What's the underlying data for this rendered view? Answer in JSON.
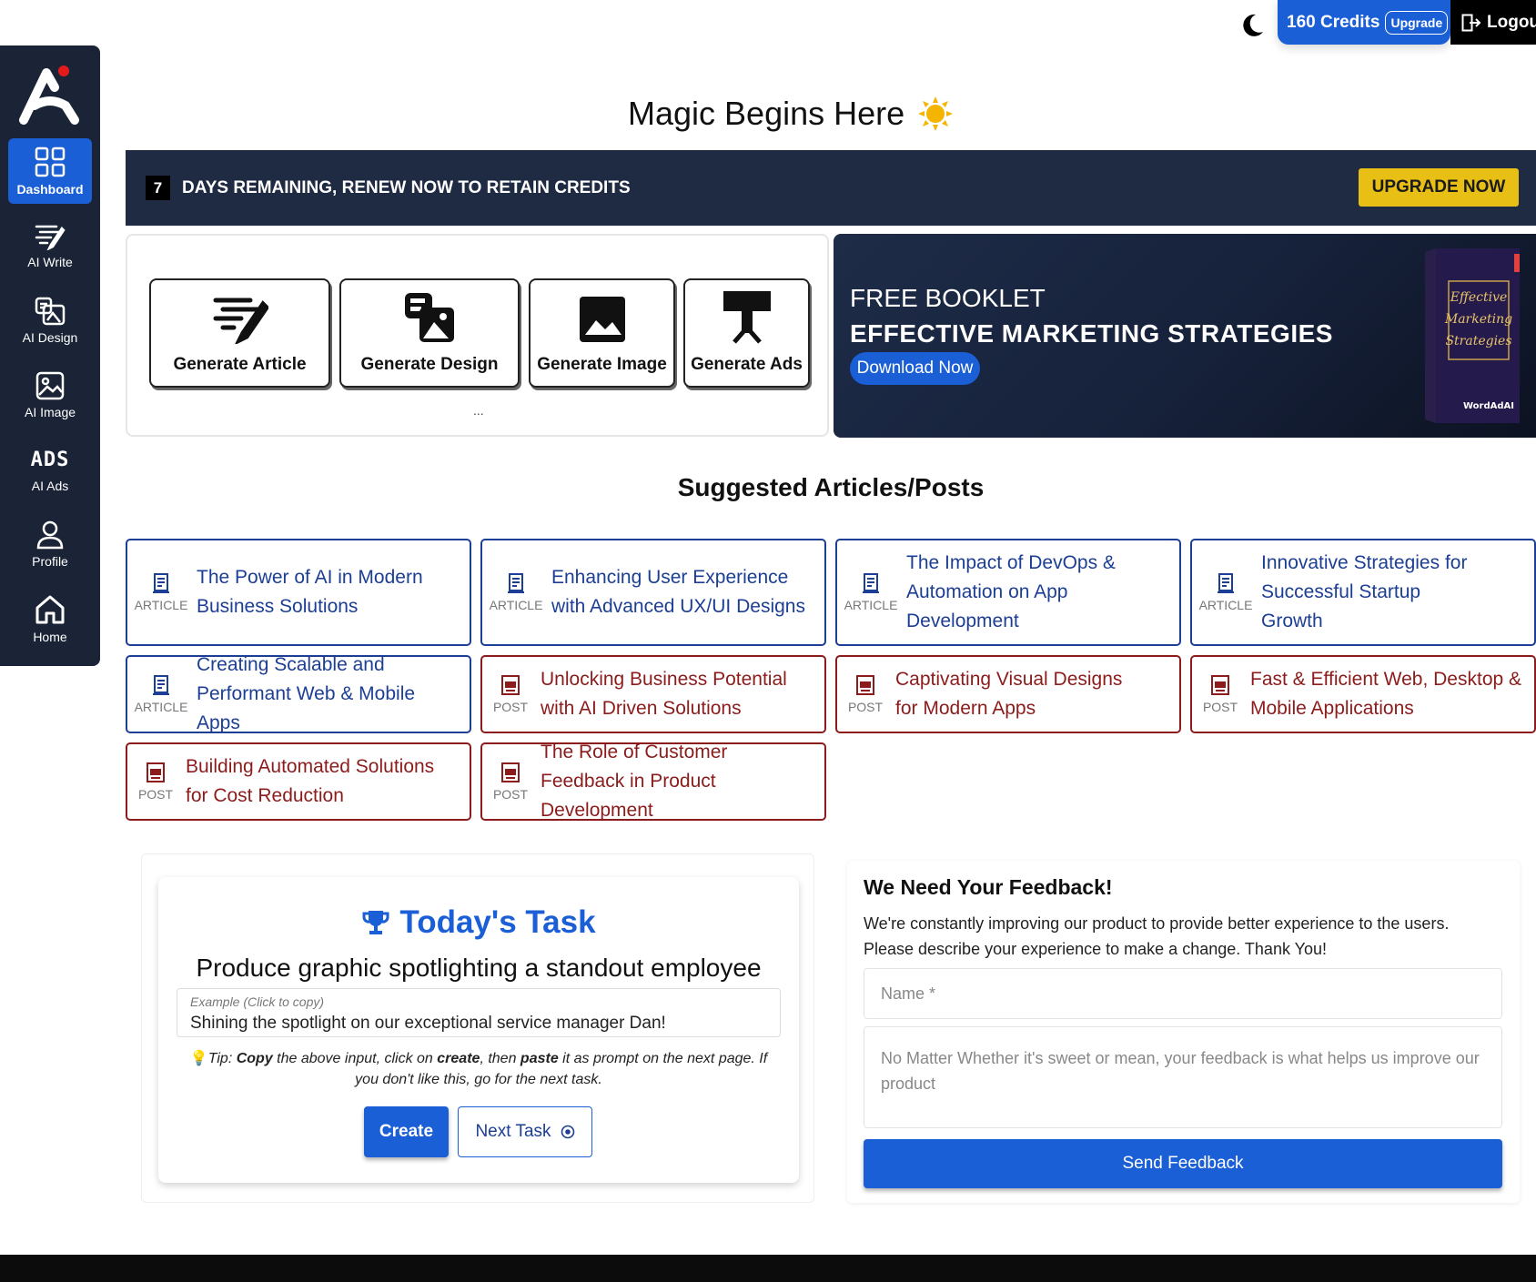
{
  "topbar": {
    "credits": "160 Credits",
    "upgrade": "Upgrade",
    "logout": "Logou"
  },
  "sidebar": {
    "items": [
      {
        "label": "Dashboard",
        "icon": "grid-icon"
      },
      {
        "label": "AI Write",
        "icon": "write-icon"
      },
      {
        "label": "AI Design",
        "icon": "design-icon"
      },
      {
        "label": "AI Image",
        "icon": "image-icon"
      },
      {
        "label": "AI Ads",
        "icon": "ads-icon",
        "glyph": "ADS"
      },
      {
        "label": "Profile",
        "icon": "user-icon"
      },
      {
        "label": "Home",
        "icon": "home-icon"
      }
    ]
  },
  "header": {
    "title": "Magic Begins Here",
    "emoji": "☀"
  },
  "banner": {
    "days": "7",
    "text": "DAYS REMAINING, RENEW NOW TO RETAIN CREDITS",
    "button": "UPGRADE NOW",
    "accent": "#e8c015"
  },
  "generate": {
    "buttons": [
      "Generate Article",
      "Generate Design",
      "Generate Image",
      "Generate Ads"
    ],
    "more": "..."
  },
  "booklet": {
    "kicker": "FREE BOOKLET",
    "title": "EFFECTIVE MARKETING STRATEGIES",
    "button": "Download Now",
    "cover_lines": [
      "Effective",
      "Marketing",
      "Strategies"
    ],
    "cover_brand": "WordAdAI"
  },
  "suggested": {
    "title": "Suggested Articles/Posts",
    "cards": [
      {
        "type": "ARTICLE",
        "title": "The Power of AI in Modern Business Solutions"
      },
      {
        "type": "ARTICLE",
        "title": "Enhancing User Experience with Advanced UX/UI Designs"
      },
      {
        "type": "ARTICLE",
        "title": "The Impact of DevOps & Automation on App Development"
      },
      {
        "type": "ARTICLE",
        "title": "Innovative Strategies for Successful Startup Growth"
      },
      {
        "type": "ARTICLE",
        "title": "Creating Scalable and Performant Web & Mobile Apps"
      },
      {
        "type": "POST",
        "title": "Unlocking Business Potential with AI Driven Solutions"
      },
      {
        "type": "POST",
        "title": "Captivating Visual Designs for Modern Apps"
      },
      {
        "type": "POST",
        "title": "Fast & Efficient Web, Desktop & Mobile Applications"
      },
      {
        "type": "POST",
        "title": "Building Automated Solutions for Cost Reduction"
      },
      {
        "type": "POST",
        "title": "The Role of Customer Feedback in Product Development"
      }
    ]
  },
  "task": {
    "title": "Today's Task",
    "description": "Produce graphic spotlighting a standout employee",
    "example_label": "Example (Click to copy)",
    "example_text": "Shining the spotlight on our exceptional service manager Dan!",
    "tip": {
      "prefix": "Tip: ",
      "copy": "Copy",
      "mid1": " the above input, click on ",
      "create": "create",
      "mid2": ", then ",
      "paste": "paste",
      "suffix": " it as prompt on the next page. If you don't like this, go for the next task."
    },
    "create_button": "Create",
    "next_button": "Next Task"
  },
  "feedback": {
    "title": "We Need Your Feedback!",
    "text": "We're constantly improving our product to provide better experience to the users. Please describe your experience to make a change. Thank You!",
    "name_placeholder": "Name *",
    "message_placeholder": "No Matter Whether it's sweet or mean, your feedback is what helps us improve our product",
    "send_button": "Send Feedback"
  },
  "colors": {
    "primary": "#1a5fd6",
    "sidebar": "#1b2436",
    "banner": "#1f2b43",
    "article": "#1c3e94",
    "post": "#8c1c1c"
  }
}
